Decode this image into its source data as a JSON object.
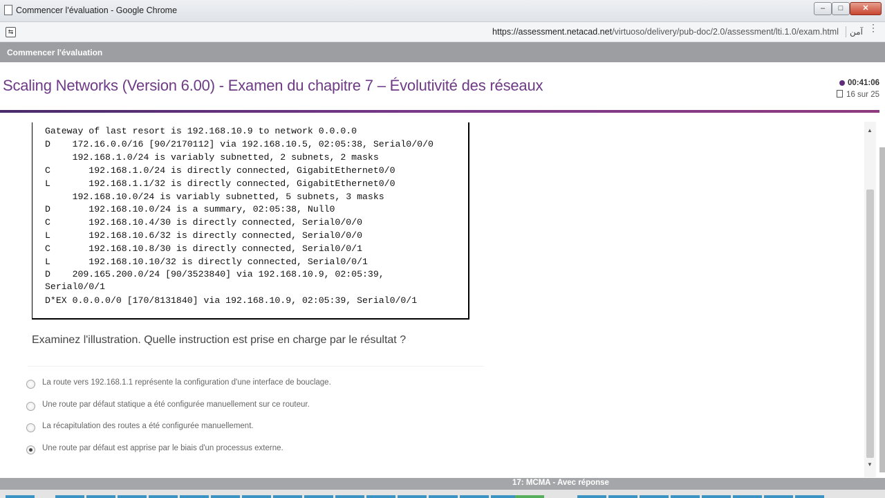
{
  "window": {
    "title": "Commencer l'évaluation - Google Chrome",
    "minimize_label": "‒",
    "maximize_label": "□",
    "close_label": "✕"
  },
  "address_bar": {
    "url_host": "https://assessment.netacad.net",
    "url_path": "/virtuoso/delivery/pub-doc/2.0/assessment/lti.1.0/exam.html",
    "secure_label": "آمن",
    "menu_icon": "⋮"
  },
  "app_header": {
    "label": "Commencer l'évaluation"
  },
  "exam": {
    "title": "Scaling Networks (Version 6.00) - Examen du chapitre 7 – Évolutivité des réseaux",
    "timer": "00:41:06",
    "progress": "16 sur 25"
  },
  "exhibit": {
    "lines": [
      "Gateway of last resort is 192.168.10.9 to network 0.0.0.0",
      "D    172.16.0.0/16 [90/2170112] via 192.168.10.5, 02:05:38, Serial0/0/0",
      "     192.168.1.0/24 is variably subnetted, 2 subnets, 2 masks",
      "C       192.168.1.0/24 is directly connected, GigabitEthernet0/0",
      "L       192.168.1.1/32 is directly connected, GigabitEthernet0/0",
      "     192.168.10.0/24 is variably subnetted, 5 subnets, 3 masks",
      "D       192.168.10.0/24 is a summary, 02:05:38, Null0",
      "C       192.168.10.4/30 is directly connected, Serial0/0/0",
      "L       192.168.10.6/32 is directly connected, Serial0/0/0",
      "C       192.168.10.8/30 is directly connected, Serial0/0/1",
      "L       192.168.10.10/32 is directly connected, Serial0/0/1",
      "D    209.165.200.0/24 [90/3523840] via 192.168.10.9, 02:05:39,",
      "Serial0/0/1",
      "D*EX 0.0.0.0/0 [170/8131840] via 192.168.10.9, 02:05:39, Serial0/0/1"
    ]
  },
  "question": {
    "text": "Examinez l'illustration. Quelle instruction est prise en charge par le résultat ?",
    "options": [
      {
        "label": "La route vers 192.168.1.1 représente la configuration d'une interface de bouclage.",
        "selected": false
      },
      {
        "label": "Une route par défaut statique a été configurée manuellement sur ce routeur.",
        "selected": false
      },
      {
        "label": "La récapitulation des routes a été configurée manuellement.",
        "selected": false
      },
      {
        "label": "Une route par défaut est apprise par le biais d'un processus externe.",
        "selected": true
      }
    ]
  },
  "footer": {
    "status": "17: MCMA - Avec réponse"
  },
  "colors": {
    "title_purple": "#6e3a86",
    "accent_line": "#7a3a8a",
    "nav_blue": "#3b93c4",
    "nav_green": "#56b05b"
  },
  "icons": {
    "page": "page-icon",
    "clock": "clock-icon",
    "progress": "document-icon",
    "scroll_up": "scroll-up-arrow-icon",
    "scroll_down": "scroll-down-arrow-icon"
  }
}
